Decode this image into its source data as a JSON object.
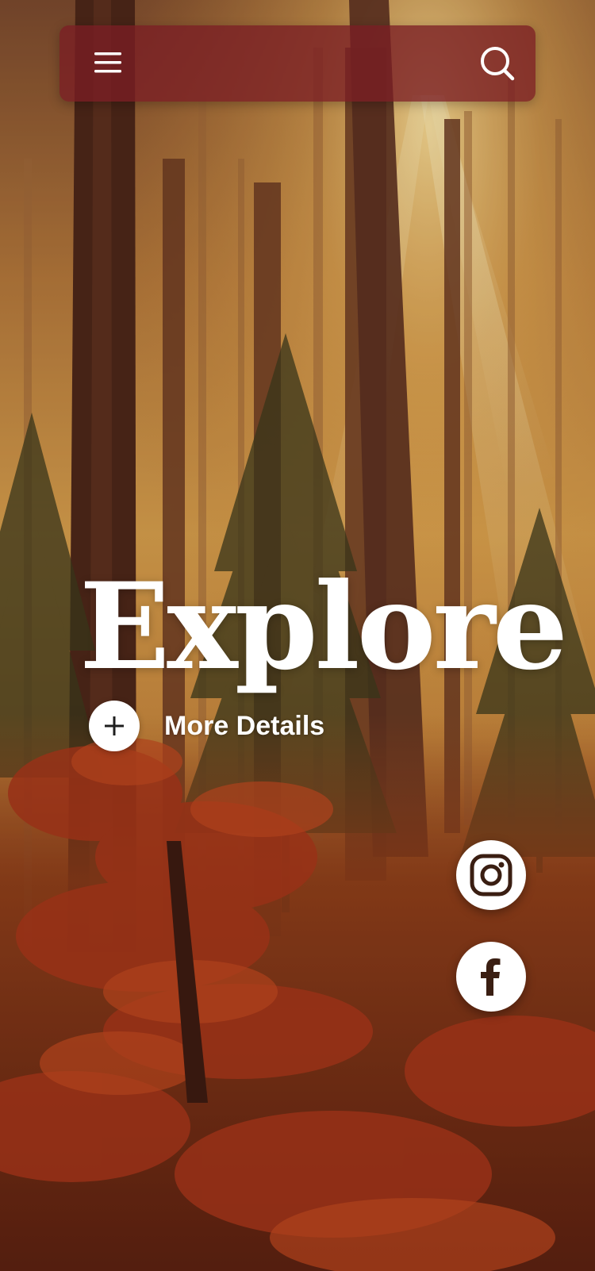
{
  "hero": {
    "title": "Explore",
    "more_details_label": "More Details"
  },
  "icons": {
    "menu": "hamburger-menu-icon",
    "search": "search-icon",
    "more": "plus-icon",
    "instagram": "instagram-icon",
    "facebook": "facebook-icon"
  },
  "colors": {
    "topbar": "#7a1e24",
    "text": "#ffffff",
    "social_glyph": "#3a1e12"
  }
}
